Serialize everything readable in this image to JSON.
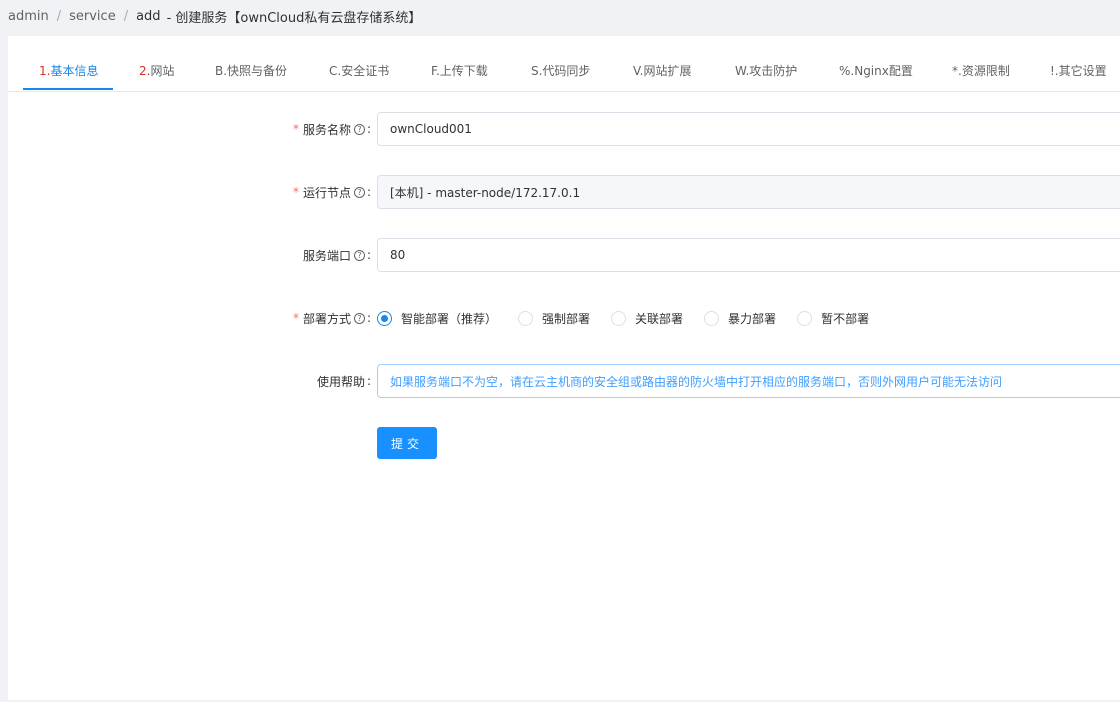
{
  "breadcrumb": {
    "items": [
      "admin",
      "service"
    ],
    "current": "add",
    "title": "- 创建服务【ownCloud私有云盘存储系统】"
  },
  "tabs": [
    {
      "num": "1.",
      "label": "基本信息"
    },
    {
      "num": "2.",
      "label": "网站"
    },
    {
      "num": "",
      "label": "B.快照与备份"
    },
    {
      "num": "",
      "label": "C.安全证书"
    },
    {
      "num": "",
      "label": "F.上传下载"
    },
    {
      "num": "",
      "label": "S.代码同步"
    },
    {
      "num": "",
      "label": "V.网站扩展"
    },
    {
      "num": "",
      "label": "W.攻击防护"
    },
    {
      "num": "",
      "label": "%.Nginx配置"
    },
    {
      "num": "",
      "label": "*.资源限制"
    },
    {
      "num": "",
      "label": "!.其它设置"
    }
  ],
  "form": {
    "service_name": {
      "label": "服务名称",
      "value": "ownCloud001"
    },
    "node": {
      "label": "运行节点",
      "value": "[本机] - master-node/172.17.0.1"
    },
    "port": {
      "label": "服务端口",
      "value": "80"
    },
    "deploy": {
      "label": "部署方式",
      "options": [
        "智能部署（推荐）",
        "强制部署",
        "关联部署",
        "暴力部署",
        "暂不部署"
      ],
      "selected": "智能部署（推荐）"
    },
    "help": {
      "label": "使用帮助",
      "text": "如果服务端口不为空，请在云主机商的安全组或路由器的防火墙中打开相应的服务端口，否则外网用户可能无法访问"
    },
    "submit_label": "提交",
    "required_mark": "*",
    "help_icon_glyph": "?",
    "colon": ":"
  },
  "colors": {
    "accent": "#1a86e8",
    "required": "#f56c6c",
    "tip": "#409eff"
  }
}
